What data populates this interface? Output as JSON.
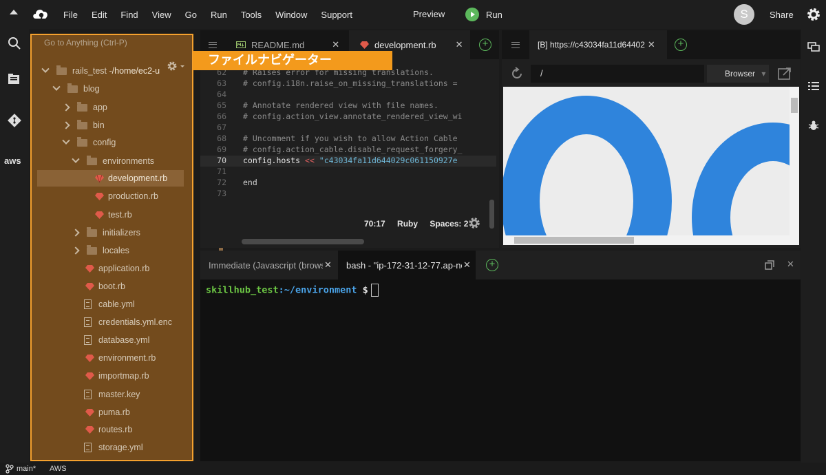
{
  "menubar": {
    "items": [
      "File",
      "Edit",
      "Find",
      "View",
      "Go",
      "Run",
      "Tools",
      "Window",
      "Support"
    ],
    "preview": "Preview",
    "run": "Run",
    "avatar_letter": "S",
    "share": "Share"
  },
  "leftbar": {
    "aws": "aws"
  },
  "tree": {
    "goto_placeholder": "Go to Anything (Ctrl-P)",
    "root_name": "rails_test - ",
    "root_path": "/home/ec2-u",
    "nodes": [
      {
        "label": "blog"
      },
      {
        "label": "app"
      },
      {
        "label": "bin"
      },
      {
        "label": "config"
      },
      {
        "label": "environments"
      },
      {
        "label": "development.rb"
      },
      {
        "label": "production.rb"
      },
      {
        "label": "test.rb"
      },
      {
        "label": "initializers"
      },
      {
        "label": "locales"
      },
      {
        "label": "application.rb"
      },
      {
        "label": "boot.rb"
      },
      {
        "label": "cable.yml"
      },
      {
        "label": "credentials.yml.enc"
      },
      {
        "label": "database.yml"
      },
      {
        "label": "environment.rb"
      },
      {
        "label": "importmap.rb"
      },
      {
        "label": "master.key"
      },
      {
        "label": "puma.rb"
      },
      {
        "label": "routes.rb"
      },
      {
        "label": "storage.yml"
      }
    ]
  },
  "callout": "ファイルナビゲーター",
  "editor": {
    "tabs": [
      "README.md",
      "development.rb"
    ],
    "lines": [
      {
        "n": "62",
        "text": "# Raises error for missing translations."
      },
      {
        "n": "63",
        "text": "# config.i18n.raise_on_missing_translations = "
      },
      {
        "n": "64",
        "text": ""
      },
      {
        "n": "65",
        "text": "# Annotate rendered view with file names."
      },
      {
        "n": "66",
        "text": "# config.action_view.annotate_rendered_view_wi"
      },
      {
        "n": "67",
        "text": ""
      },
      {
        "n": "68",
        "text": "# Uncomment if you wish to allow Action Cable "
      },
      {
        "n": "69",
        "text": "# config.action_cable.disable_request_forgery_"
      },
      {
        "n": "70",
        "pre": "config.hosts ",
        "op": "<<",
        "str": " \"c43034fa11d644029c061150927e"
      },
      {
        "n": "71",
        "text": ""
      },
      {
        "n": "72",
        "text": "end"
      },
      {
        "n": "73",
        "text": ""
      }
    ],
    "status": {
      "position": "70:17",
      "lang": "Ruby",
      "spaces": "Spaces: 2"
    }
  },
  "browser": {
    "tab": "[B] https://c43034fa11d64402",
    "url": "/",
    "selector": "Browser"
  },
  "terminal": {
    "tabs": [
      "Immediate (Javascript (brows",
      "bash - \"ip-172-31-12-77.ap-nc"
    ],
    "prompt_user": "skillhub_test",
    "prompt_path": ":~/environment",
    "prompt_symbol": " $"
  },
  "statusbar": {
    "branch": "main*",
    "aws": "AWS"
  }
}
